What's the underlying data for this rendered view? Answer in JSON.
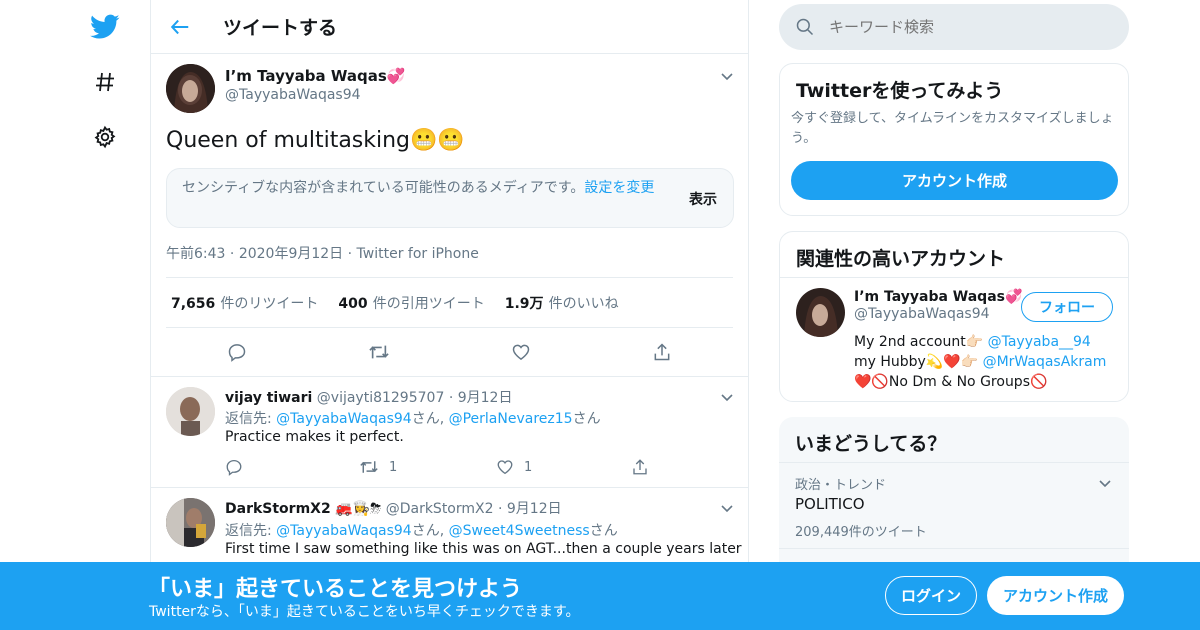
{
  "header": {
    "title": "ツイートする"
  },
  "tweet": {
    "author_name": "I’m Tayyaba Waqas",
    "author_emoji": "💞",
    "author_handle": "@TayyabaWaqas94",
    "text": "Queen of multitasking",
    "text_emoji": "😬😬",
    "sensitive_notice": "センシティブな内容が含まれている可能性のあるメディアです。",
    "sensitive_link": "設定を変更",
    "sensitive_show": "表示",
    "time": "午前6:43",
    "date": "2020年9月12日",
    "source": "Twitter for iPhone",
    "retweets_count": "7,656",
    "retweets_label": "件のリツイート",
    "quotes_count": "400",
    "quotes_label": "件の引用ツイート",
    "likes_count": "1.9万",
    "likes_label": "件のいいね"
  },
  "replies": [
    {
      "name": "vijay tiwari",
      "handle": "@vijayti81295707",
      "date": "9月12日",
      "reply_prefix": "返信先:",
      "reply_to_1": "@TayyabaWaqas94",
      "san1": "さん,",
      "reply_to_2": "@PerlaNevarez15",
      "san2": "さん",
      "text": "Practice makes it perfect.",
      "retweets": "1",
      "likes": "1"
    },
    {
      "name": "DarkStormX2",
      "name_emoji": "🚒👩‍🍳⛈",
      "handle": "@DarkStormX2",
      "date": "9月12日",
      "reply_prefix": "返信先:",
      "reply_to_1": "@TayyabaWaqas94",
      "san1": "さん,",
      "reply_to_2": "@Sweet4Sweetness",
      "san2": "さん",
      "text": "First time I saw something like this was on AGT...then a couple years later"
    }
  ],
  "search": {
    "placeholder": "キーワード検索"
  },
  "signup_card": {
    "title": "Twitterを使ってみよう",
    "desc": "今すぐ登録して、タイムラインをカスタマイズしましょう。",
    "button": "アカウント作成"
  },
  "related_card": {
    "title": "関連性の高いアカウント",
    "name": "I’m Tayyaba Waqas",
    "name_emoji": "💞",
    "handle": "@TayyabaWaqas94",
    "follow": "フォロー",
    "bio_1_text": "My 2nd account👉🏻",
    "bio_1_link": "@Tayyaba__94",
    "bio_2_text": "my Hubby💫❤️👉🏻",
    "bio_2_link": "@MrWaqasAkram",
    "bio_3_text": "❤️🚫No Dm & No Groups🚫"
  },
  "trends_card": {
    "title": "いまどうしてる？",
    "trend_category": "政治・トレンド",
    "trend_name": "POLITICO",
    "trend_count": "209,449件のツイート"
  },
  "bottom_bar": {
    "headline": "「いま」起きていることを見つけよう",
    "subline": "Twitterなら、「いま」起きていることをいち早くチェックできます。",
    "login": "ログイン",
    "signup": "アカウント作成"
  },
  "colors": {
    "brand": "#1da1f2",
    "text": "#14171a",
    "muted": "#657786",
    "border": "#e6ecf0"
  }
}
